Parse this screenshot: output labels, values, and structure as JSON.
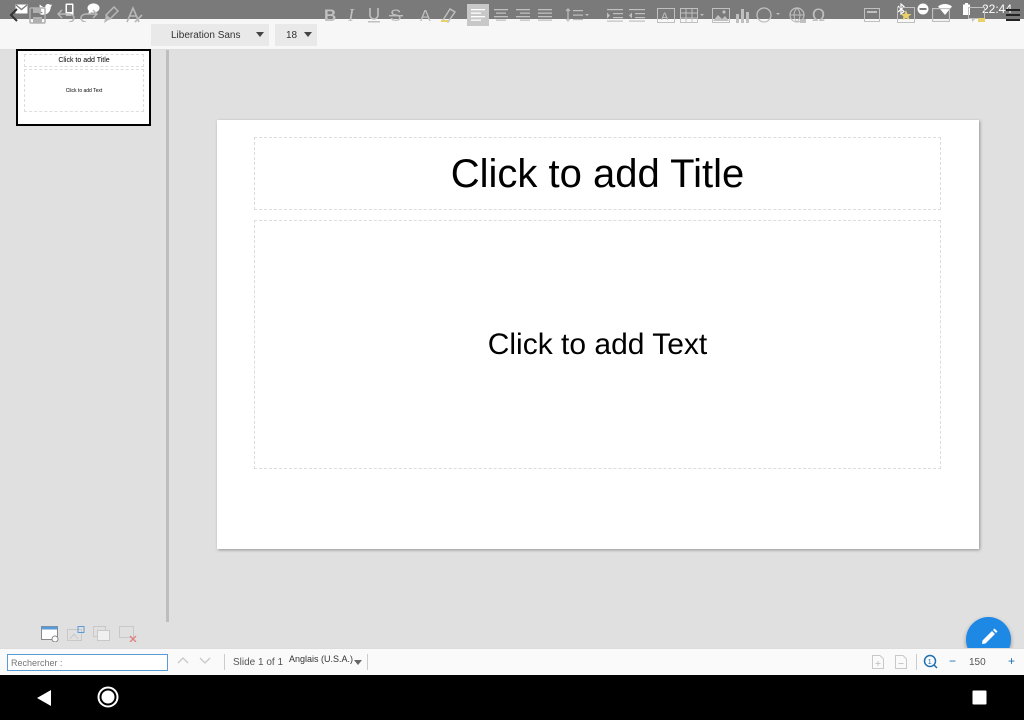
{
  "status_bar": {
    "time": "22:44",
    "left_icons": [
      "gmail-icon",
      "twitter-icon",
      "phone-icon",
      "chat-icon"
    ],
    "right_icons": [
      "bluetooth-icon",
      "do-not-disturb-icon",
      "wifi-icon",
      "battery-icon"
    ]
  },
  "toolbar": {
    "font_name": "Liberation Sans",
    "font_size": "18",
    "accent_color": "#1e88e5"
  },
  "thumbnail": {
    "title": "Click to add Title",
    "body": "Click to add Text"
  },
  "slide": {
    "title_placeholder": "Click to add Title",
    "body_placeholder": "Click to add Text"
  },
  "bottom_bar": {
    "search_placeholder": "Rechercher :",
    "slide_info": "Slide 1 of 1",
    "language": "Anglais (U.S.A.)",
    "zoom": "150",
    "zoom_minus": "−",
    "zoom_plus": "+"
  }
}
